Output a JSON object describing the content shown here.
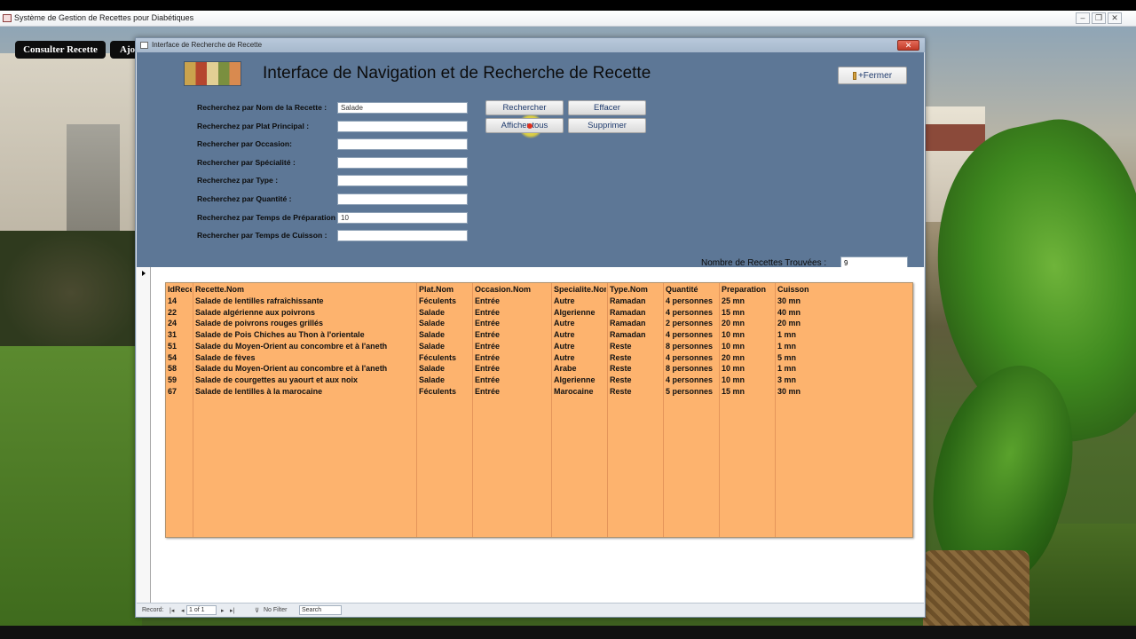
{
  "app": {
    "title": "Système de Gestion de Recettes pour Diabétiques",
    "window_buttons": [
      "–",
      "❐",
      "✕"
    ]
  },
  "ribbon_tabs": [
    "Consulter Recette",
    "Ajo"
  ],
  "form": {
    "window_title": "Interface de Recherche de Recette",
    "close_glyph": "✕",
    "heading": "Interface de Navigation et de Recherche de Recette",
    "close_button": "+Fermer",
    "fields": [
      {
        "label": "Recherchez par Nom de la Recette :",
        "value": "Salade"
      },
      {
        "label": "Recherchez par Plat Principal :",
        "value": ""
      },
      {
        "label": "Rechercher par Occasion:",
        "value": ""
      },
      {
        "label": "Rechercher par Spécialité :",
        "value": ""
      },
      {
        "label": "Recherchez par Type :",
        "value": ""
      },
      {
        "label": "Recherchez par Quantité :",
        "value": ""
      },
      {
        "label": "Recherchez par Temps de Préparation :",
        "value": "10"
      },
      {
        "label": "Rechercher par Temps de Cuisson :",
        "value": ""
      }
    ],
    "buttons": {
      "rechercher": "Rechercher",
      "effacer": "Effacer",
      "afficher_tous": "Afficher tous",
      "supprimer": "Supprimer"
    },
    "count_label": "Nombre de Recettes Trouvées :",
    "count_value": "9"
  },
  "results": {
    "columns": [
      "IdRecette",
      "Recette.Nom",
      "Plat.Nom",
      "Occasion.Nom",
      "Specialite.Nom",
      "Type.Nom",
      "Quantité",
      "Preparation",
      "Cuisson"
    ],
    "rows": [
      [
        "14",
        "Salade de lentilles rafraîchissante",
        "Féculents",
        "Entrée",
        "Autre",
        "Ramadan",
        "4 personnes",
        "25 mn",
        "30 mn"
      ],
      [
        "22",
        "Salade algérienne aux poivrons",
        "Salade",
        "Entrée",
        "Algerienne",
        "Ramadan",
        "4 personnes",
        "15 mn",
        "40 mn"
      ],
      [
        "24",
        "Salade de poivrons rouges grillés",
        "Salade",
        "Entrée",
        "Autre",
        "Ramadan",
        "2 personnes",
        "20 mn",
        "20 mn"
      ],
      [
        "31",
        "Salade de Pois Chiches au Thon à l'orientale",
        "Salade",
        "Entrée",
        "Autre",
        "Ramadan",
        "4 personnes",
        "10 mn",
        "1 mn"
      ],
      [
        "51",
        "Salade du Moyen-Orient au concombre et à l'aneth",
        "Salade",
        "Entrée",
        "Autre",
        "Reste",
        "8 personnes",
        "10 mn",
        "1 mn"
      ],
      [
        "54",
        "Salade de fèves",
        "Féculents",
        "Entrée",
        "Autre",
        "Reste",
        "4 personnes",
        "20 mn",
        "5 mn"
      ],
      [
        "58",
        "Salade du Moyen-Orient au concombre et à l'aneth",
        "Salade",
        "Entrée",
        "Arabe",
        "Reste",
        "8 personnes",
        "10 mn",
        "1 mn"
      ],
      [
        "59",
        "Salade de courgettes au yaourt et aux noix",
        "Salade",
        "Entrée",
        "Algerienne",
        "Reste",
        "4 personnes",
        "10 mn",
        "3 mn"
      ],
      [
        "67",
        "Salade de lentilles à la marocaine",
        "Féculents",
        "Entrée",
        "Marocaine",
        "Reste",
        "5 personnes",
        "15 mn",
        "30 mn"
      ]
    ]
  },
  "status": {
    "record_label": "Record:",
    "nav_first": "|◂",
    "nav_prev": "◂",
    "record_position": "1 of 1",
    "nav_next": "▸",
    "nav_last": "▸|",
    "filter_label": "No Filter",
    "search_label": "Search"
  },
  "colors": {
    "header_bg": "#5d7796",
    "grid_bg": "#fdb36e"
  }
}
